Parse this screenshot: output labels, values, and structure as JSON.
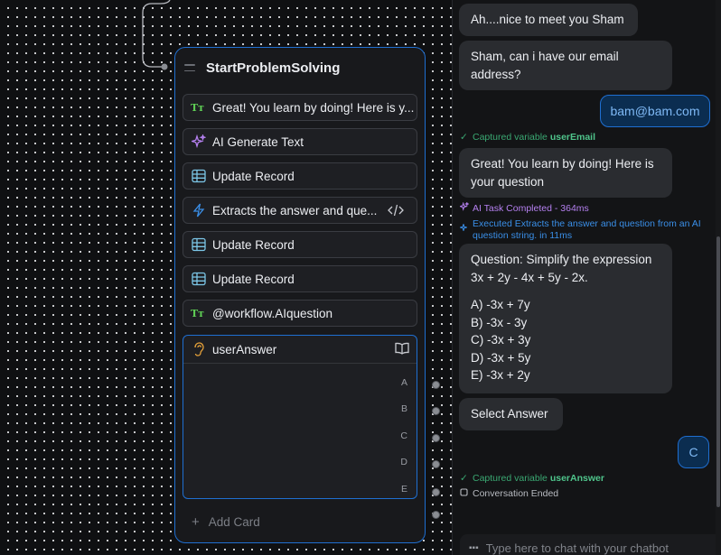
{
  "flow": {
    "group_title": "StartProblemSolving",
    "blocks": [
      {
        "label": "Great! You learn by doing! Here is y...",
        "icon": "text-bubble-icon"
      },
      {
        "label": "AI Generate Text",
        "icon": "sparkles-icon"
      },
      {
        "label": "Update Record",
        "icon": "table-icon"
      },
      {
        "label": "Extracts the answer and que...",
        "icon": "lightning-icon"
      },
      {
        "label": "Update Record",
        "icon": "table-icon"
      },
      {
        "label": "Update Record",
        "icon": "table-icon"
      },
      {
        "label": "@workflow.AIquestion",
        "icon": "text-bubble-icon"
      }
    ],
    "input_block": {
      "variable": "userAnswer",
      "icon": "ear-icon",
      "choices": [
        "A",
        "B",
        "C",
        "D",
        "E"
      ]
    },
    "add_card_label": "Add Card"
  },
  "chat": {
    "messages": [
      {
        "role": "bot",
        "text": "Ah....nice to meet you Sham"
      },
      {
        "role": "bot",
        "lines": [
          "Sham, can i have our email",
          "address?"
        ]
      },
      {
        "role": "user",
        "text": "bam@bam.com"
      },
      {
        "role": "log",
        "prefix": "Captured variable",
        "var": "userEmail"
      },
      {
        "role": "bot",
        "lines": [
          "Great! You learn by doing! Here is",
          "your question"
        ]
      },
      {
        "role": "log",
        "text": "AI Task Completed - 364ms"
      },
      {
        "role": "log",
        "lines": [
          "Executed Extracts the answer and question from an AI",
          "question string. in 11ms"
        ]
      },
      {
        "role": "bot",
        "lines": [
          "Question: Simplify the expression",
          "3x + 2y - 4x + 5y - 2x.",
          "A) -3x + 7y",
          "B) -3x - 3y",
          "C) -3x + 3y",
          "D) -3x + 5y",
          "E) -3x + 2y"
        ]
      },
      {
        "role": "bot",
        "text": "Select Answer"
      },
      {
        "role": "user",
        "text": "C"
      },
      {
        "role": "log",
        "prefix": "Captured variable",
        "var": "userAnswer"
      },
      {
        "role": "log",
        "text": "Conversation Ended"
      }
    ],
    "input_placeholder": "Type here to chat with your chatbot"
  },
  "colors": {
    "accent": "#1f6fd1",
    "captured": "#3aa872",
    "ai_task": "#b580f0",
    "executed": "#3a8fe8"
  }
}
